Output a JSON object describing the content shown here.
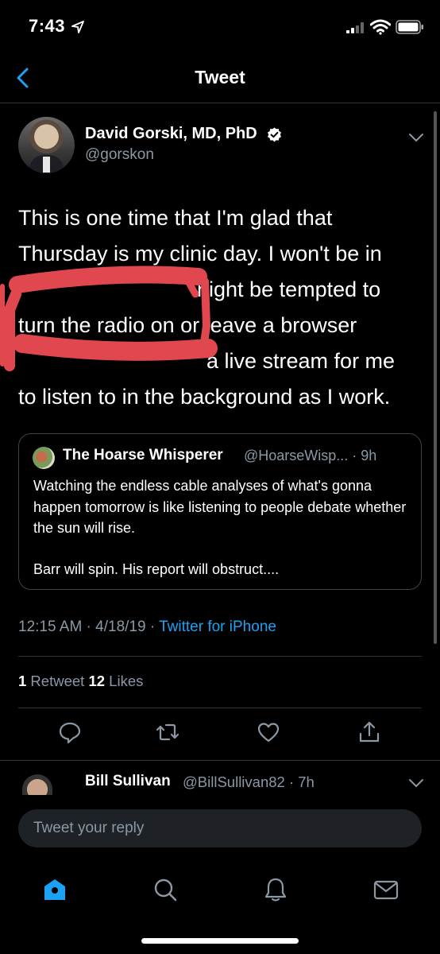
{
  "status_bar": {
    "time": "7:43"
  },
  "nav": {
    "title": "Tweet"
  },
  "tweet": {
    "author_name": "David Gorski, MD, PhD",
    "author_handle": "@gorskon",
    "text_lines": [
      "This is one time that I'm glad that",
      "Thursday is my clinic day. I won't be in",
      "night be tempted to",
      "turn the radio on or leave a browser",
      "a live stream for me",
      "to listen to in the background as I work."
    ],
    "timestamp": "12:15 AM · 4/18/19 · ",
    "source": "Twitter for iPhone",
    "retweet_count": "1",
    "retweet_label": " Retweet ",
    "like_count": "12",
    "like_label": " Likes"
  },
  "quoted_tweet": {
    "author_name": "The Hoarse Whisperer",
    "author_handle": "@HoarseWisp... · 9h",
    "text": "Watching the endless cable analyses of what's gonna happen tomorrow is like listening to people debate whether the sun will rise.",
    "text2": "Barr will spin. His report will obstruct...."
  },
  "reply": {
    "author_name": "Bill Sullivan",
    "author_handle": "@BillSullivan82 · 7h"
  },
  "composer": {
    "placeholder": "Tweet your reply"
  },
  "colors": {
    "accent": "#1da1f2",
    "secondary_text": "#8b98a5",
    "redaction": "#e0474f",
    "background": "#000000"
  }
}
